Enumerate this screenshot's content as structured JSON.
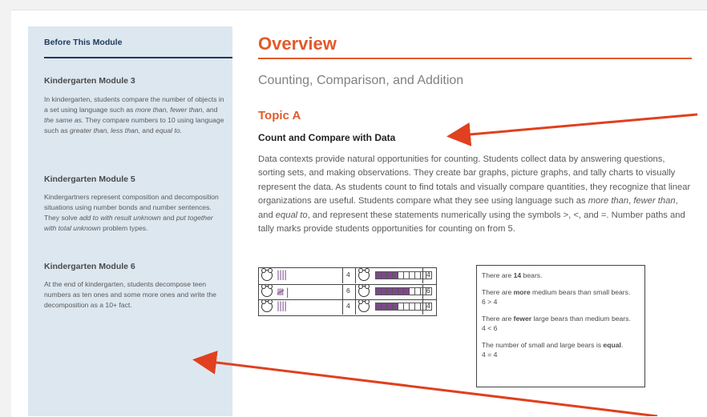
{
  "sidebar": {
    "title": "Before This Module",
    "sections": [
      {
        "heading": "Kindergarten Module 3",
        "text": "In kindergarten, students compare the number of objects in a set using language such as <i>more than, fewer than,</i> and <i>the same as.</i> They compare numbers to 10 using language such as <i>greater than, less than,</i> and <i>equal to.</i>"
      },
      {
        "heading": "Kindergarten Module 5",
        "text": "Kindergartners represent composition and decomposition situations using number bonds and number sentences. They solve <i>add to with result unknown</i> and <i>put together with total unknown</i> problem types."
      },
      {
        "heading": "Kindergarten Module 6",
        "text": "At the end of kindergarten, students decompose teen numbers as ten ones and some more ones and write the decomposition as a 10+ fact."
      }
    ]
  },
  "main": {
    "title": "Overview",
    "subtitle": "Counting, Comparison, and Addition",
    "topic": "Topic A",
    "topic_subtitle": "Count and Compare with Data",
    "body": "Data contexts provide natural opportunities for counting. Students collect data by answering questions, sorting sets, and making observations. They create bar graphs, picture graphs, and tally charts to visually represent the data. As students count to find totals and visually compare quantities, they recognize that linear organizations are useful. Students compare what they see using language such as <i>more than</i>, <i>fewer than</i>, and <i>equal to</i>, and represent these statements numerically using the symbols &gt;, &lt;, and =. Number paths and tally marks provide students opportunities for counting on from 5."
  },
  "tally_table": {
    "rows": [
      {
        "tally": "||||",
        "count": "4",
        "bars_filled": 4,
        "bars_total": 10
      },
      {
        "tally": "𝍸 |",
        "count": "6",
        "bars_filled": 6,
        "bars_total": 10
      },
      {
        "tally": "||||",
        "count": "4",
        "bars_filled": 4,
        "bars_total": 10
      }
    ]
  },
  "info_box": [
    "There are <b>14</b> bears.",
    "There are <b>more</b> medium bears than small bears.<br>6 &gt; 4",
    "There are <b>fewer</b> large bears than medium bears.<br>4 &lt; 6",
    "The number of small and large bears is <b>equal</b>.<br>4 = 4"
  ],
  "colors": {
    "accent": "#e25a2b",
    "navy": "#1f3a5a",
    "sidebar_bg": "#dce7f0",
    "tally": "#7a4a86"
  }
}
